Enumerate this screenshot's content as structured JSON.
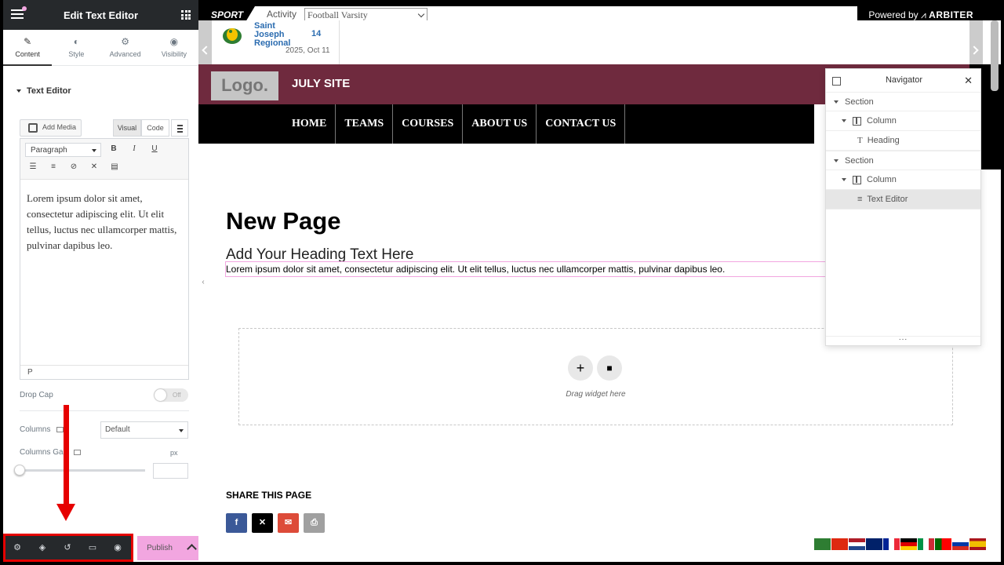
{
  "panel": {
    "title": "Edit Text Editor",
    "tabs": [
      {
        "label": "Content",
        "icon": "pencil-icon"
      },
      {
        "label": "Style",
        "icon": "contrast-icon"
      },
      {
        "label": "Advanced",
        "icon": "gear-icon"
      },
      {
        "label": "Visibility",
        "icon": "eye-icon"
      }
    ],
    "section_title": "Text Editor",
    "add_media_label": "Add Media",
    "visual_tab": "Visual",
    "code_tab": "Code",
    "format_select": "Paragraph",
    "toolbar": {
      "bold": "B",
      "italic": "I",
      "underline": "U"
    },
    "editor_text": "Lorem ipsum dolor sit amet, consectetur adipiscing elit. Ut elit tellus, luctus nec ullamcorper mattis, pulvinar dapibus leo.",
    "path_label": "P",
    "drop_cap_label": "Drop Cap",
    "drop_cap_toggle": "Off",
    "columns_label": "Columns",
    "columns_value": "Default",
    "columns_gap_label": "Columns Gap",
    "unit": "px",
    "publish_label": "Publish"
  },
  "site": {
    "sport_label": "SPORT",
    "activity_label": "Activity",
    "activity_value": "Football Varsity",
    "powered_by": "Powered by",
    "powered_brand": "ARBITER",
    "score": {
      "team": "Saint Joseph Regional",
      "score": "14",
      "date": "2025, Oct 11"
    },
    "logo_text": "Logo.",
    "site_name": "JULY SITE",
    "nav": [
      "HOME",
      "TEAMS",
      "COURSES",
      "ABOUT US",
      "CONTACT US"
    ],
    "page_title": "New Page",
    "heading": "Add Your Heading Text Here",
    "body_text": "Lorem ipsum dolor sit amet, consectetur adipiscing elit. Ut elit tellus, luctus nec ullamcorper mattis, pulvinar dapibus leo.",
    "drag_text": "Drag widget here",
    "share_title": "SHARE THIS PAGE",
    "share_buttons": [
      {
        "icon": "facebook-icon",
        "color": "#3b5998"
      },
      {
        "icon": "x-icon",
        "color": "#000000"
      },
      {
        "icon": "email-icon",
        "color": "#dd4b39"
      },
      {
        "icon": "print-icon",
        "color": "#a0a0a0"
      }
    ],
    "header_color": "#6f2a3e"
  },
  "navigator": {
    "title": "Navigator",
    "items": [
      {
        "label": "Section",
        "level": 0
      },
      {
        "label": "Column",
        "level": 1
      },
      {
        "label": "Heading",
        "level": 2
      },
      {
        "label": "Section",
        "level": 0
      },
      {
        "label": "Column",
        "level": 1
      },
      {
        "label": "Text Editor",
        "level": 2,
        "selected": true
      }
    ],
    "footer": "..."
  }
}
